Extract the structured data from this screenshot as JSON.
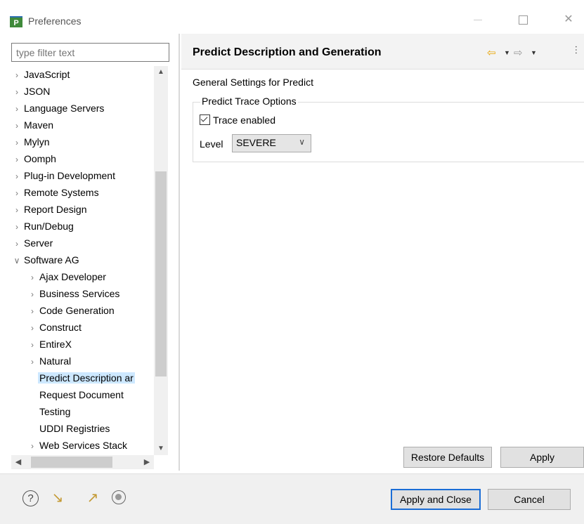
{
  "window": {
    "title": "Preferences",
    "app_icon_letter": "P"
  },
  "filter": {
    "placeholder": "type filter text"
  },
  "tree": [
    {
      "label": "JavaScript",
      "level": 0,
      "arrow": "›"
    },
    {
      "label": "JSON",
      "level": 0,
      "arrow": "›"
    },
    {
      "label": "Language Servers",
      "level": 0,
      "arrow": "›"
    },
    {
      "label": "Maven",
      "level": 0,
      "arrow": "›"
    },
    {
      "label": "Mylyn",
      "level": 0,
      "arrow": "›"
    },
    {
      "label": "Oomph",
      "level": 0,
      "arrow": "›"
    },
    {
      "label": "Plug-in Development",
      "level": 0,
      "arrow": "›"
    },
    {
      "label": "Remote Systems",
      "level": 0,
      "arrow": "›"
    },
    {
      "label": "Report Design",
      "level": 0,
      "arrow": "›"
    },
    {
      "label": "Run/Debug",
      "level": 0,
      "arrow": "›"
    },
    {
      "label": "Server",
      "level": 0,
      "arrow": "›"
    },
    {
      "label": "Software AG",
      "level": 0,
      "arrow": "∨"
    },
    {
      "label": "Ajax Developer",
      "level": 1,
      "arrow": "›"
    },
    {
      "label": "Business Services",
      "level": 1,
      "arrow": "›"
    },
    {
      "label": "Code Generation",
      "level": 1,
      "arrow": "›"
    },
    {
      "label": "Construct",
      "level": 1,
      "arrow": "›"
    },
    {
      "label": "EntireX",
      "level": 1,
      "arrow": "›"
    },
    {
      "label": "Natural",
      "level": 1,
      "arrow": "›"
    },
    {
      "label": "Predict Description ar",
      "level": 1,
      "arrow": "",
      "selected": true
    },
    {
      "label": "Request Document",
      "level": 1,
      "arrow": ""
    },
    {
      "label": "Testing",
      "level": 1,
      "arrow": ""
    },
    {
      "label": "UDDI Registries",
      "level": 1,
      "arrow": ""
    },
    {
      "label": "Web Services Stack",
      "level": 1,
      "arrow": "›"
    }
  ],
  "page": {
    "title": "Predict Description and Generation",
    "general_label": "General Settings for Predict",
    "group_title": "Predict Trace Options",
    "trace_label": "Trace enabled",
    "trace_checked": true,
    "level_label": "Level",
    "level_value": "SEVERE"
  },
  "buttons": {
    "restore_defaults": "Restore Defaults",
    "apply": "Apply",
    "apply_and_close": "Apply and Close",
    "cancel": "Cancel"
  },
  "icons": {
    "back": "⇦",
    "forward": "⇨",
    "dropdown": "▼",
    "more": "…",
    "help": "?",
    "import": "↘",
    "export": "↗",
    "close": "✕"
  },
  "colors": {
    "accent": "#1a6dd6",
    "selection": "#cde8ff",
    "nav_back": "#e9a400"
  }
}
